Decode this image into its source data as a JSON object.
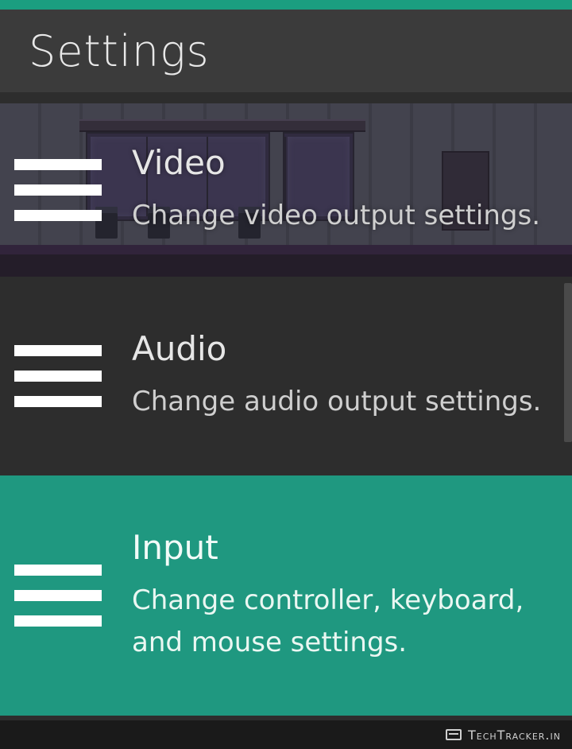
{
  "header": {
    "title": "Settings"
  },
  "items": [
    {
      "title": "Video",
      "desc": "Change video output settings."
    },
    {
      "title": "Audio",
      "desc": "Change audio output settings."
    },
    {
      "title": "Input",
      "desc": "Change controller, keyboard, and mouse settings."
    }
  ],
  "selected_index": 2,
  "footer": {
    "watermark": "TechTracker.in"
  }
}
